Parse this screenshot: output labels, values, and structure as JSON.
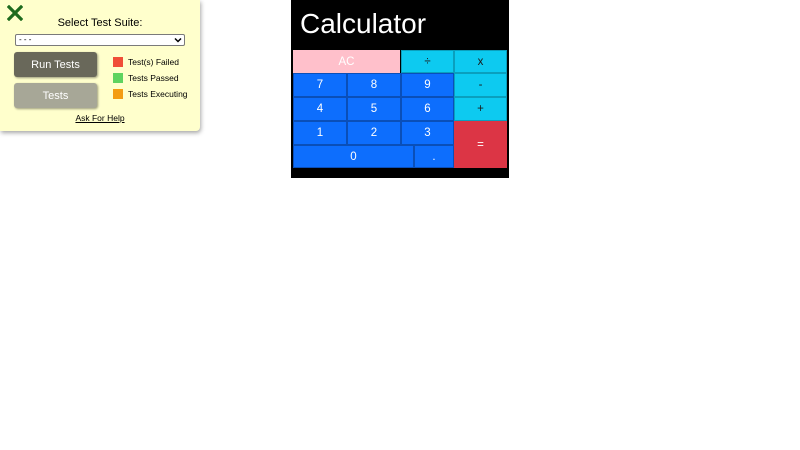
{
  "test_panel": {
    "suite_label": "Select Test Suite:",
    "suite_selected": "- - -",
    "run_tests_label": "Run Tests",
    "tests_label": "Tests",
    "legend": [
      {
        "label": "Test(s) Failed",
        "color": "#f04e37"
      },
      {
        "label": "Tests Passed",
        "color": "#5fd35f"
      },
      {
        "label": "Tests Executing",
        "color": "#f39c12"
      }
    ],
    "help_link": "Ask For Help",
    "close_icon": "close-x-icon",
    "close_color": "#1e6b1e"
  },
  "calculator": {
    "display": "Calculator",
    "keys": {
      "clear": "AC",
      "divide": "÷",
      "multiply": "x",
      "seven": "7",
      "eight": "8",
      "nine": "9",
      "subtract": "-",
      "four": "4",
      "five": "5",
      "six": "6",
      "add": "+",
      "one": "1",
      "two": "2",
      "three": "3",
      "equals": "=",
      "zero": "0",
      "decimal": "."
    },
    "colors": {
      "number": "#0d6efd",
      "operator": "#0dcaf0",
      "clear": "#ffc0cb",
      "equals": "#dc3545",
      "body": "#000000"
    }
  }
}
